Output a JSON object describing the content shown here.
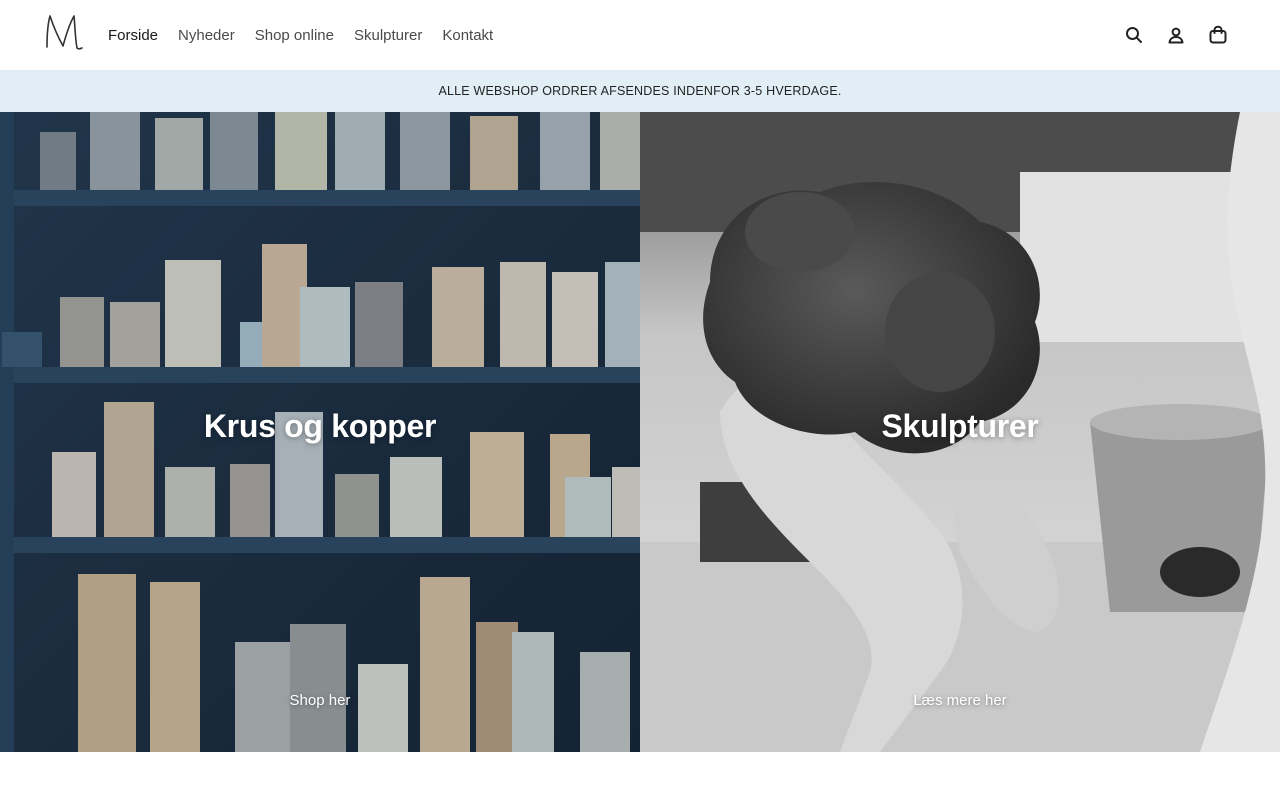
{
  "header": {
    "logo_alt": "M",
    "nav": [
      {
        "label": "Forside",
        "active": true
      },
      {
        "label": "Nyheder",
        "active": false
      },
      {
        "label": "Shop online",
        "active": false
      },
      {
        "label": "Skulpturer",
        "active": false
      },
      {
        "label": "Kontakt",
        "active": false
      }
    ],
    "icons": [
      "search-icon",
      "account-icon",
      "cart-icon"
    ]
  },
  "announcement": {
    "text": "ALLE WEBSHOP ORDRER AFSENDES INDENFOR 3-5 HVERDAGE.",
    "background": "#e2eef5"
  },
  "tiles": [
    {
      "title": "Krus og kopper",
      "link_label": "Shop her"
    },
    {
      "title": "Skulpturer",
      "link_label": "Læs mere her"
    }
  ]
}
